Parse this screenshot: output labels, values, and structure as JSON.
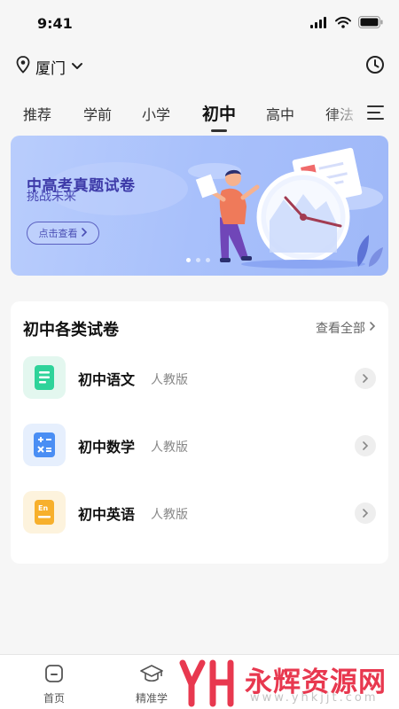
{
  "status": {
    "time": "9:41"
  },
  "location": {
    "city": "厦门"
  },
  "tabs": [
    {
      "label": "推荐"
    },
    {
      "label": "学前"
    },
    {
      "label": "小学"
    },
    {
      "label": "初中",
      "active": true
    },
    {
      "label": "高中"
    },
    {
      "label": "律法"
    }
  ],
  "banner": {
    "title": "中高考真题试卷",
    "subtitle": "挑战未来",
    "button_label": "点击查看",
    "slides": 3,
    "active_slide": 1
  },
  "section": {
    "title": "初中各类试卷",
    "view_all": "查看全部",
    "items": [
      {
        "subject": "初中语文",
        "edition": "人教版",
        "icon": "chinese-book-icon",
        "color": "#2fd39a",
        "bg": "#e3f7ef"
      },
      {
        "subject": "初中数学",
        "edition": "人教版",
        "icon": "math-book-icon",
        "color": "#4a8ef4",
        "bg": "#e6effd"
      },
      {
        "subject": "初中英语",
        "edition": "人教版",
        "icon": "english-book-icon",
        "color": "#f7b02c",
        "bg": "#fdf3dd"
      }
    ]
  },
  "bottom_nav": {
    "items": [
      {
        "label": "首页",
        "icon": "home-icon"
      },
      {
        "label": "精准学",
        "icon": "graduation-cap-icon"
      }
    ]
  },
  "watermark": {
    "brand": "永辉资源网",
    "url": "www.yhkjjt.com"
  },
  "colors": {
    "accent": "#3d3aa8",
    "watermark_red": "#e8384f"
  }
}
